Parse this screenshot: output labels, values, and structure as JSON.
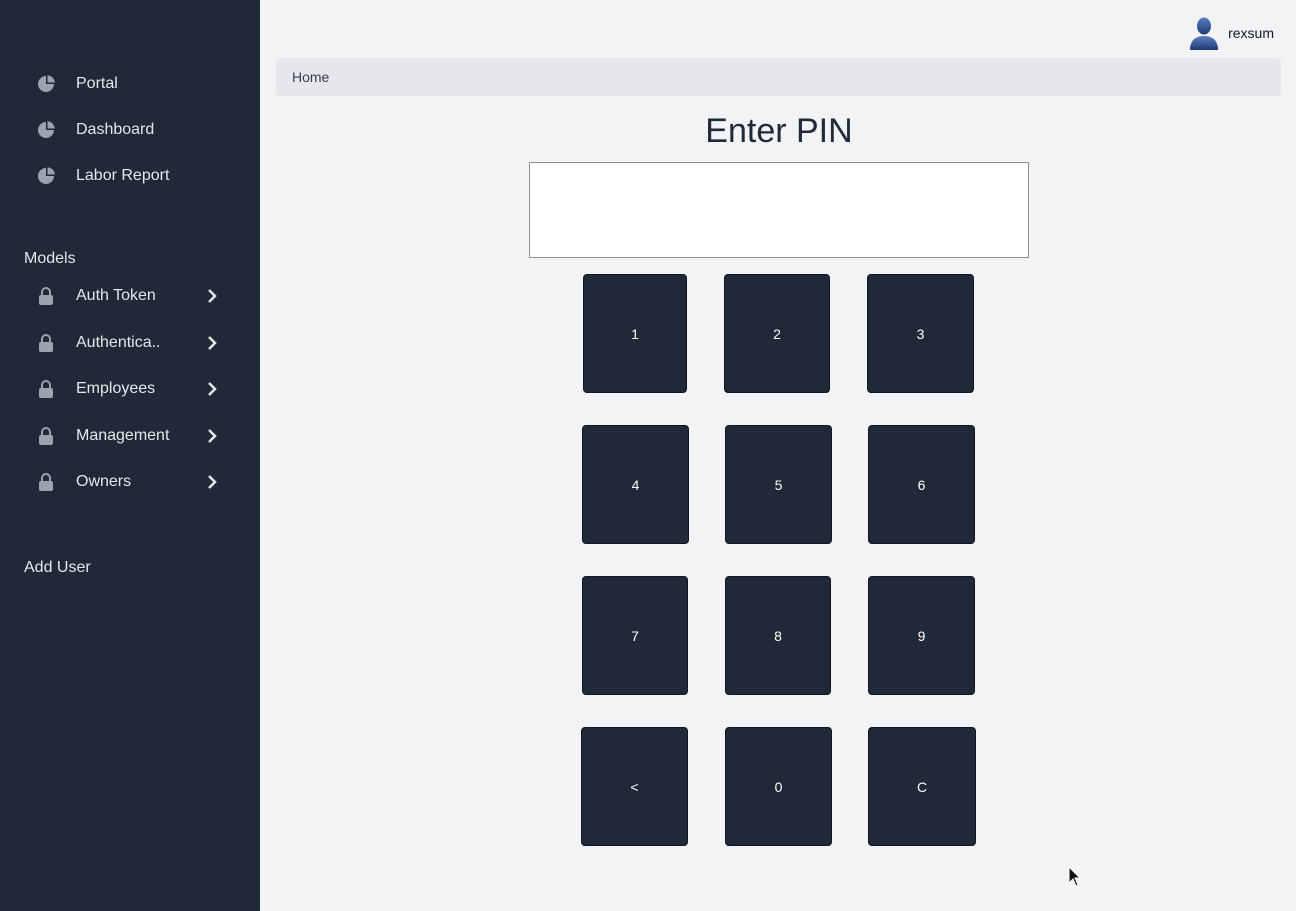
{
  "sidebar": {
    "top_items": [
      {
        "label": "Portal",
        "icon": "pie-chart-icon"
      },
      {
        "label": "Dashboard",
        "icon": "pie-chart-icon"
      },
      {
        "label": "Labor Report",
        "icon": "pie-chart-icon"
      }
    ],
    "section_title": "Models",
    "model_items": [
      {
        "label": "Auth Token",
        "icon": "lock-icon"
      },
      {
        "label": "Authentica..",
        "icon": "lock-icon"
      },
      {
        "label": "Employees",
        "icon": "lock-icon"
      },
      {
        "label": "Management",
        "icon": "lock-icon"
      },
      {
        "label": "Owners",
        "icon": "lock-icon"
      }
    ],
    "add_user": "Add User"
  },
  "header": {
    "username": "rexsum"
  },
  "breadcrumb": {
    "home": "Home"
  },
  "pin": {
    "title": "Enter PIN",
    "value": "",
    "keys": [
      "1",
      "2",
      "3",
      "4",
      "5",
      "6",
      "7",
      "8",
      "9",
      "<",
      "0",
      "C"
    ]
  },
  "colors": {
    "sidebar_bg": "#1f2937",
    "page_bg": "#f2f3f5",
    "key_bg": "#1f2937"
  }
}
